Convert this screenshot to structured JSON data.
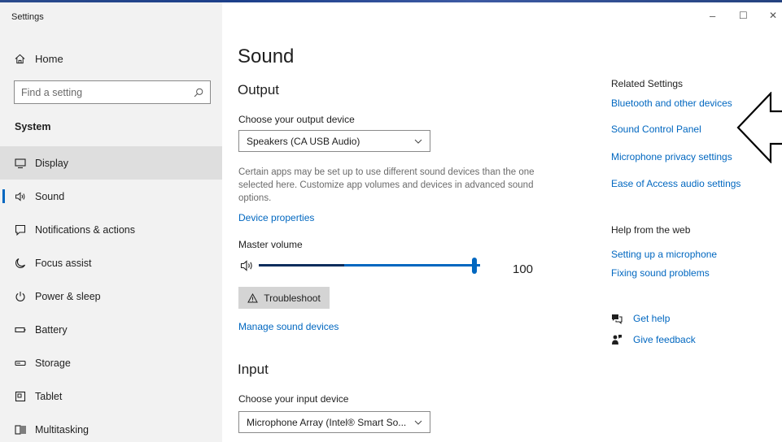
{
  "window": {
    "title": "Settings",
    "minimize_glyph": "–",
    "maximize_glyph": "☐",
    "close_glyph": "✕"
  },
  "sidebar": {
    "home_label": "Home",
    "search_placeholder": "Find a setting",
    "section_label": "System",
    "items": [
      {
        "label": "Display",
        "icon": "monitor-icon"
      },
      {
        "label": "Sound",
        "icon": "speaker-icon"
      },
      {
        "label": "Notifications & actions",
        "icon": "notification-icon"
      },
      {
        "label": "Focus assist",
        "icon": "moon-icon"
      },
      {
        "label": "Power & sleep",
        "icon": "power-icon"
      },
      {
        "label": "Battery",
        "icon": "battery-icon"
      },
      {
        "label": "Storage",
        "icon": "storage-icon"
      },
      {
        "label": "Tablet",
        "icon": "tablet-icon"
      },
      {
        "label": "Multitasking",
        "icon": "multitasking-icon"
      }
    ],
    "selected": "Sound",
    "hovered": "Display"
  },
  "main": {
    "title": "Sound",
    "output": {
      "heading": "Output",
      "device_label": "Choose your output device",
      "device_value": "Speakers (CA USB Audio)",
      "description": "Certain apps may be set up to use different sound devices than the one selected here. Customize app volumes and devices in advanced sound options.",
      "device_properties_link": "Device properties",
      "volume_label": "Master volume",
      "volume_value": "100",
      "volume_level": 1.0,
      "troubleshoot_label": "Troubleshoot",
      "manage_link": "Manage sound devices"
    },
    "input": {
      "heading": "Input",
      "device_label": "Choose your input device",
      "device_value": "Microphone Array (Intel® Smart So..."
    }
  },
  "related": {
    "heading": "Related Settings",
    "links": [
      "Bluetooth and other devices",
      "Sound Control Panel",
      "Microphone privacy settings",
      "Ease of Access audio settings"
    ],
    "help_heading": "Help from the web",
    "help_links": [
      "Setting up a microphone",
      "Fixing sound problems"
    ],
    "get_help": "Get help",
    "give_feedback": "Give feedback"
  },
  "colors": {
    "accent": "#0067c0",
    "sidebar_bg": "#f2f2f2",
    "hover_bg": "#dedede"
  }
}
